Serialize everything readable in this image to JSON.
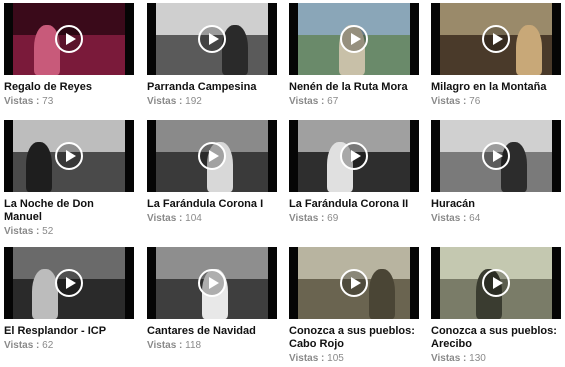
{
  "views_label": "Vistas :",
  "videos": [
    {
      "title": "Regalo de Reyes",
      "views": "73"
    },
    {
      "title": "Parranda Campesina",
      "views": "192"
    },
    {
      "title": "Nenén de la Ruta Mora",
      "views": "67"
    },
    {
      "title": "Milagro en la Montaña",
      "views": "76"
    },
    {
      "title": "La Noche de Don Manuel",
      "views": "52"
    },
    {
      "title": "La Farándula Corona I",
      "views": "104"
    },
    {
      "title": "La Farándula Corona II",
      "views": "69"
    },
    {
      "title": "Huracán",
      "views": "64"
    },
    {
      "title": "El Resplandor - ICP",
      "views": "62"
    },
    {
      "title": "Cantares de Navidad",
      "views": "118"
    },
    {
      "title": "Conozca a sus pueblos: Cabo Rojo",
      "views": "105"
    },
    {
      "title": "Conozca a sus pueblos: Arecibo",
      "views": "130"
    }
  ],
  "thumb_colors": [
    {
      "sky": "#3a0a1a",
      "ground": "#7a1a3a",
      "figure": "#c85a7a"
    },
    {
      "sky": "#cfcfcf",
      "ground": "#5a5a5a",
      "figure": "#2a2a2a"
    },
    {
      "sky": "#8aa6b8",
      "ground": "#6a8a6a",
      "figure": "#c8c0a8"
    },
    {
      "sky": "#9a8a6a",
      "ground": "#4a3a2a",
      "figure": "#c8a878"
    },
    {
      "sky": "#bdbdbd",
      "ground": "#4a4a4a",
      "figure": "#1e1e1e"
    },
    {
      "sky": "#8a8a8a",
      "ground": "#3a3a3a",
      "figure": "#d8d8d8"
    },
    {
      "sky": "#a0a0a0",
      "ground": "#2e2e2e",
      "figure": "#e0e0e0"
    },
    {
      "sky": "#d0d0d0",
      "ground": "#7a7a7a",
      "figure": "#2c2c2c"
    },
    {
      "sky": "#6a6a6a",
      "ground": "#2a2a2a",
      "figure": "#bcbcbc"
    },
    {
      "sky": "#8e8e8e",
      "ground": "#3e3e3e",
      "figure": "#e8e8e8"
    },
    {
      "sky": "#b8b4a0",
      "ground": "#6a6450",
      "figure": "#4a4535"
    },
    {
      "sky": "#c4c8b0",
      "ground": "#7a7c68",
      "figure": "#3a3c30"
    }
  ]
}
